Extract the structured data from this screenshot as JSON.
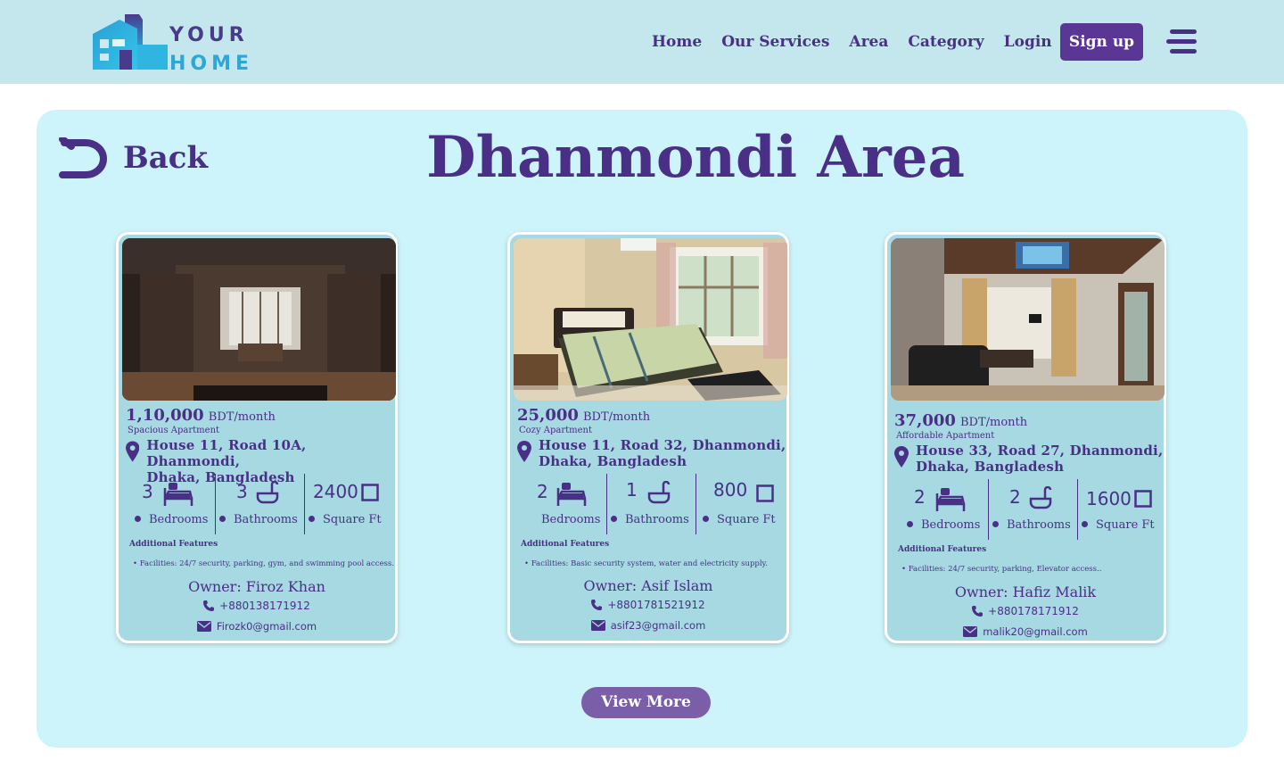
{
  "brand": {
    "line1": "YOUR",
    "line2": "HOME",
    "logo_icon": "house-building-icon"
  },
  "nav": {
    "links": [
      "Home",
      "Our Services",
      "Area",
      "Category",
      "Login"
    ],
    "signup_label": "Sign up",
    "menu_icon": "hamburger-menu-icon"
  },
  "page": {
    "back_label": "Back",
    "title": "Dhanmondi Area",
    "view_more_label": "View More"
  },
  "listings": [
    {
      "price": "1,10,000",
      "price_unit": "BDT/month",
      "type": "Spacious Apartment",
      "address_line1": "House 11, Road 10A, Dhanmondi,",
      "address_line2": "Dhaka, Bangladesh",
      "bedrooms": "3",
      "bathrooms": "3",
      "area": "2400",
      "bedrooms_label": "Bedrooms",
      "bathrooms_label": "Bathrooms",
      "area_label": "Square Ft",
      "features_heading": "Additional Features",
      "facilities": "Facilities: 24/7 security, parking, gym, and swimming pool access.",
      "owner": "Owner: Firoz Khan",
      "phone": "+880138171912",
      "email": "Firozk0@gmail.com"
    },
    {
      "price": "25,000",
      "price_unit": "BDT/month",
      "type": "Cozy Apartment",
      "address_line1": "House 11, Road 32, Dhanmondi,",
      "address_line2": "Dhaka, Bangladesh",
      "bedrooms": "2",
      "bathrooms": "1",
      "area": "800",
      "bedrooms_label": "Bedrooms",
      "bathrooms_label": "Bathrooms",
      "area_label": "Square Ft",
      "features_heading": "Additional Features",
      "facilities": "Facilities: Basic security system, water and electricity supply.",
      "owner": "Owner: Asif Islam",
      "phone": "+8801781521912",
      "email": "asif23@gmail.com"
    },
    {
      "price": "37,000",
      "price_unit": "BDT/month",
      "type": "Affordable Apartment",
      "address_line1": "House 33, Road 27, Dhanmondi,",
      "address_line2": "Dhaka, Bangladesh",
      "bedrooms": "2",
      "bathrooms": "2",
      "area": "1600",
      "bedrooms_label": "Bedrooms",
      "bathrooms_label": "Bathrooms",
      "area_label": "Square Ft",
      "features_heading": "Additional Features",
      "facilities": "Facilities: 24/7 security, parking, Elevator access..",
      "owner": "Owner: Hafiz Malik",
      "phone": "+880178171912",
      "email": "malik20@gmail.com"
    }
  ],
  "colors": {
    "navbar_bg": "#c3e7ec",
    "panel_bg": "#cdf4fa",
    "card_bg": "#a7d9e2",
    "primary_purple": "#4a2f86",
    "signup_bg": "#5a3795",
    "view_more_bg": "#7a5fa8"
  }
}
